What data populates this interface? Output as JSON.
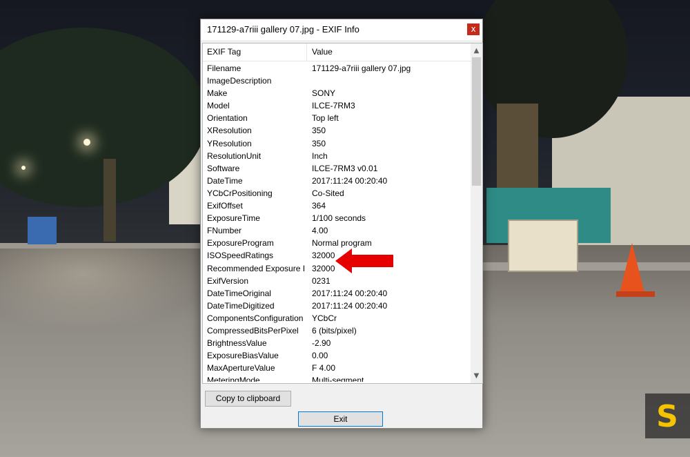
{
  "window": {
    "title": "171129-a7riii gallery 07.jpg - EXIF Info",
    "close_label": "x"
  },
  "table": {
    "columns": [
      "EXIF Tag",
      "Value"
    ],
    "rows": [
      {
        "tag": "Filename",
        "value": "171129-a7riii gallery 07.jpg"
      },
      {
        "tag": "ImageDescription",
        "value": ""
      },
      {
        "tag": "Make",
        "value": "SONY"
      },
      {
        "tag": "Model",
        "value": "ILCE-7RM3"
      },
      {
        "tag": "Orientation",
        "value": "Top left"
      },
      {
        "tag": "XResolution",
        "value": "350"
      },
      {
        "tag": "YResolution",
        "value": "350"
      },
      {
        "tag": "ResolutionUnit",
        "value": "Inch"
      },
      {
        "tag": "Software",
        "value": "ILCE-7RM3 v0.01"
      },
      {
        "tag": "DateTime",
        "value": "2017:11:24 00:20:40"
      },
      {
        "tag": "YCbCrPositioning",
        "value": "Co-Sited"
      },
      {
        "tag": "ExifOffset",
        "value": "364"
      },
      {
        "tag": "ExposureTime",
        "value": "1/100 seconds"
      },
      {
        "tag": "FNumber",
        "value": "4.00"
      },
      {
        "tag": "ExposureProgram",
        "value": "Normal program"
      },
      {
        "tag": "ISOSpeedRatings",
        "value": "32000"
      },
      {
        "tag": "Recommended Exposure I...",
        "value": "32000"
      },
      {
        "tag": "ExifVersion",
        "value": "0231"
      },
      {
        "tag": "DateTimeOriginal",
        "value": "2017:11:24 00:20:40"
      },
      {
        "tag": "DateTimeDigitized",
        "value": "2017:11:24 00:20:40"
      },
      {
        "tag": "ComponentsConfiguration",
        "value": "YCbCr"
      },
      {
        "tag": "CompressedBitsPerPixel",
        "value": "6 (bits/pixel)"
      },
      {
        "tag": "BrightnessValue",
        "value": "-2.90"
      },
      {
        "tag": "ExposureBiasValue",
        "value": "0.00"
      },
      {
        "tag": "MaxApertureValue",
        "value": "F 4.00"
      },
      {
        "tag": "MeteringMode",
        "value": "Multi-segment"
      }
    ]
  },
  "buttons": {
    "copy": "Copy to clipboard",
    "exit": "Exit"
  },
  "colors": {
    "close_button": "#c42b1c",
    "arrow": "#e60000",
    "logo": "#f5c400"
  },
  "icons": {
    "scroll_up": "chevron-up-icon",
    "scroll_down": "chevron-down-icon",
    "annotation": "arrow-left-icon",
    "logo": "brand-logo-icon"
  }
}
